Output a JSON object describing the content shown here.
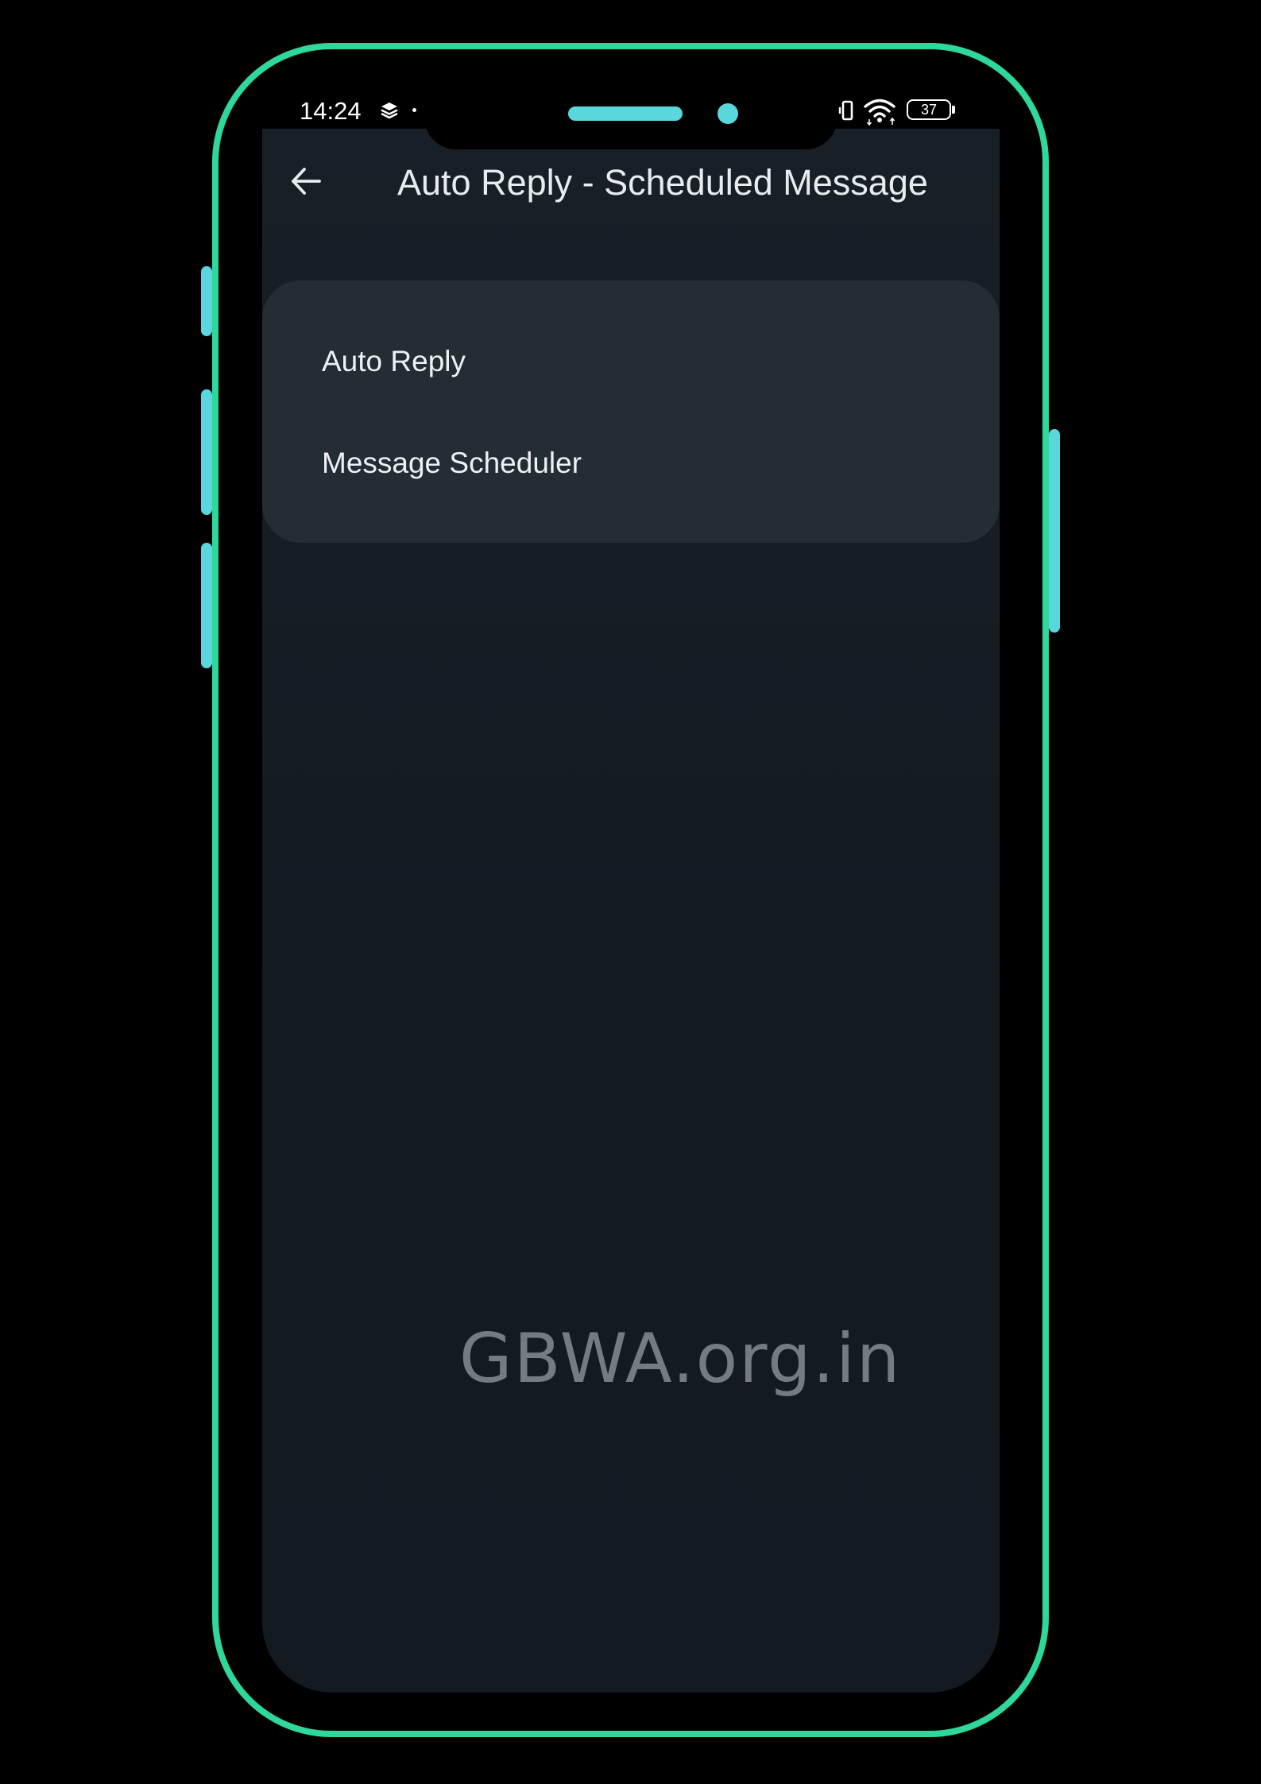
{
  "status_bar": {
    "time": "14:24",
    "battery_level": "37",
    "icons": [
      "layers-icon",
      "notification-dot-icon",
      "vibrate-icon",
      "wifi-icon",
      "battery-icon"
    ]
  },
  "app_bar": {
    "back_icon": "arrow-left-icon",
    "title": "Auto Reply - Scheduled Message"
  },
  "menu": {
    "items": [
      {
        "label": "Auto Reply"
      },
      {
        "label": "Message Scheduler"
      }
    ]
  },
  "watermark": "GBWA.org.in",
  "colors": {
    "frame": "#2ed89a",
    "accent": "#5ad7dc",
    "screen_bg": "#151c22",
    "card_bg": "#242c34",
    "text": "#eef1f3"
  }
}
